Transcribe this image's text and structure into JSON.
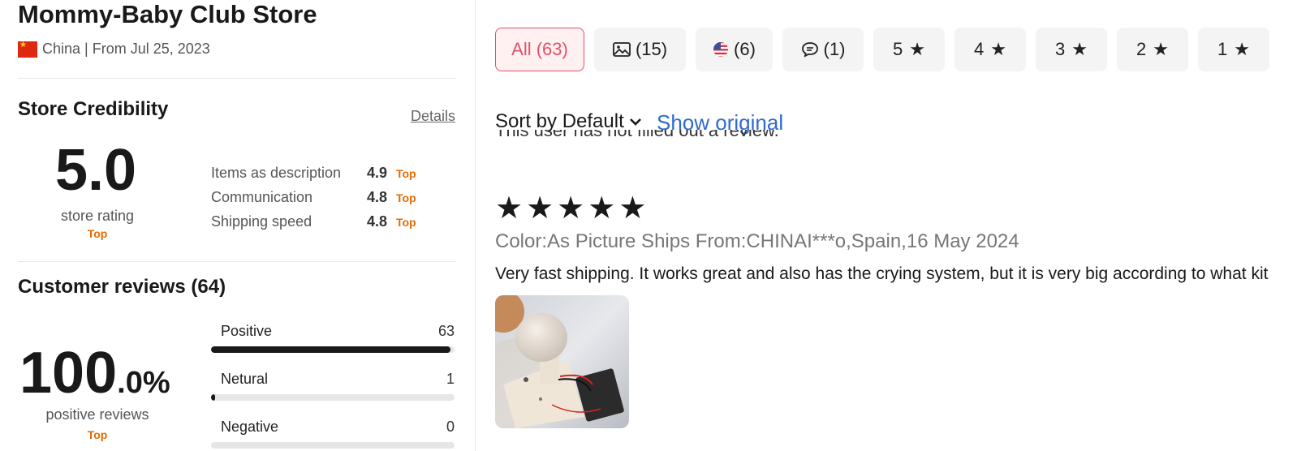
{
  "store": {
    "name": "Mommy-Baby Club Store",
    "meta": "China | From Jul 25, 2023"
  },
  "credibility": {
    "title": "Store Credibility",
    "details_label": "Details",
    "rating": "5.0",
    "rating_caption": "store rating",
    "rating_badge": "Top",
    "metrics": [
      {
        "label": "Items as description",
        "value": "4.9",
        "badge": "Top"
      },
      {
        "label": "Communication",
        "value": "4.8",
        "badge": "Top"
      },
      {
        "label": "Shipping speed",
        "value": "4.8",
        "badge": "Top"
      }
    ]
  },
  "reviews_summary": {
    "title": "Customer reviews (64)",
    "positive_int": "100",
    "positive_frac": ".0%",
    "positive_caption": "positive reviews",
    "positive_badge": "Top",
    "breakdown": [
      {
        "label": "Positive",
        "count": "63",
        "fraction": 0.984
      },
      {
        "label": "Netural",
        "count": "1",
        "fraction": 0.016
      },
      {
        "label": "Negative",
        "count": "0",
        "fraction": 0
      }
    ]
  },
  "filters": [
    {
      "label": "All (63)",
      "icon": "",
      "active": true
    },
    {
      "label": "(15)",
      "icon": "image-icon",
      "active": false
    },
    {
      "label": "(6)",
      "icon": "us-flag-icon",
      "active": false
    },
    {
      "label": "(1)",
      "icon": "comment-icon",
      "active": false
    },
    {
      "label": "5",
      "icon": "star-icon",
      "active": false
    },
    {
      "label": "4",
      "icon": "star-icon",
      "active": false
    },
    {
      "label": "3",
      "icon": "star-icon",
      "active": false
    },
    {
      "label": "2",
      "icon": "star-icon",
      "active": false
    },
    {
      "label": "1",
      "icon": "star-icon",
      "active": false
    }
  ],
  "sort": {
    "label": "Sort by Default",
    "show_original": "Show original"
  },
  "review": {
    "previous_cut_text": "This user has not filled out a review.",
    "stars": 5,
    "meta": "Color:As Picture Ships From:CHINAI***o,Spain,16 May 2024",
    "text": "Very fast shipping. It works great and also has the crying system, but it is very big according to what kit"
  },
  "colors": {
    "accent": "#e0516a",
    "badge": "#e66a00",
    "link": "#2e6ad1"
  }
}
